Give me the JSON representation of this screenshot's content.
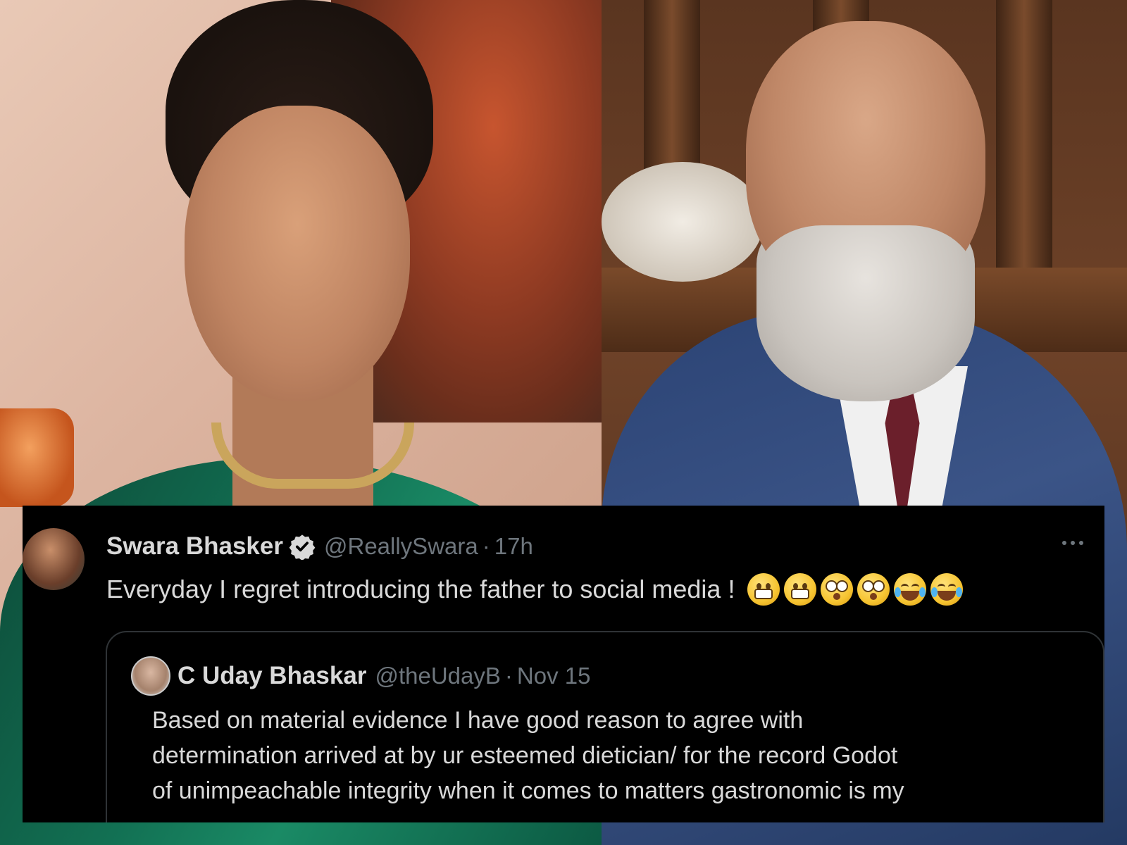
{
  "tweet": {
    "author_name": "Swara Bhasker",
    "verified": true,
    "handle": "@ReallySwara",
    "separator": "·",
    "time": "17h",
    "text": "Everyday I regret introducing the father to social media !",
    "emojis": [
      "grimacing",
      "grimacing",
      "flushed",
      "flushed",
      "joy",
      "joy"
    ],
    "more_icon": "ellipsis-icon"
  },
  "quote": {
    "author_name": "C Uday Bhaskar",
    "handle": "@theUdayB",
    "separator": "·",
    "date": "Nov 15",
    "text_lines": [
      "Based on material evidence I have good reason to agree with",
      "determination arrived at by ur esteemed dietician/ for the record Godot",
      "of unimpeachable integrity when it comes to matters gastronomic is my"
    ]
  },
  "colors": {
    "tweet_bg": "#000000",
    "text": "#d9d9d9",
    "muted": "#6e767d",
    "verified": "#d9d9d9",
    "quote_border": "#2f3336"
  }
}
